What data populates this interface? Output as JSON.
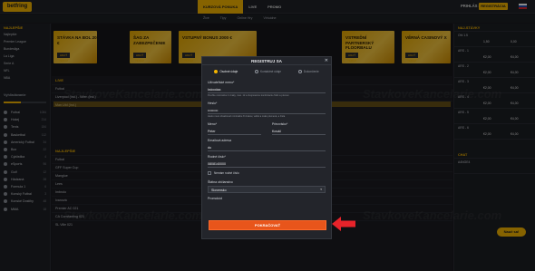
{
  "topbar": {
    "logo": "betfring",
    "nav": [
      "KURZOVÁ PONUKA",
      "LIVE",
      "PROMO"
    ],
    "login": "PRIHLÁS SA",
    "register": "REGISTRÁCIA"
  },
  "subtabs": [
    "Živé",
    "Tipy",
    "Online Hry",
    "Virtuálne"
  ],
  "sidebar": {
    "heading": "NAJLEPŠIE",
    "links": [
      "Najlepšie",
      "Premier League",
      "Bundesliga",
      "La Liga",
      "Serie A",
      "NFL",
      "NBA"
    ],
    "section": "Vyhľadávanie",
    "sports": [
      {
        "name": "Futbal",
        "count": "1084"
      },
      {
        "name": "Hokej",
        "count": "214"
      },
      {
        "name": "Tenis",
        "count": "184"
      },
      {
        "name": "Basketbal",
        "count": "112"
      },
      {
        "name": "Americký Futbal",
        "count": "34"
      },
      {
        "name": "Box",
        "count": "22"
      },
      {
        "name": "Cyklistika",
        "count": "4"
      },
      {
        "name": "eSports",
        "count": "96"
      },
      {
        "name": "Golf",
        "count": "12"
      },
      {
        "name": "Hádzaná",
        "count": "28"
      },
      {
        "name": "Formula 1",
        "count": "6"
      },
      {
        "name": "Konský Futbal",
        "count": "3"
      },
      {
        "name": "Konské Dostihy",
        "count": "48"
      },
      {
        "name": "MMA",
        "count": "18"
      }
    ]
  },
  "banners": [
    {
      "text": "STÁVKA NA BOL 20 €"
    },
    {
      "text": "ŠAG ZA ZABEZPEČENIE"
    },
    {
      "text": "VSTUPNÝ BONUS 2000 €"
    },
    {
      "text": "VSTREĎNÍ PARTNERSKÝ FLOORBALU"
    },
    {
      "text": "VĚRNÁ CASINOVÝ X"
    }
  ],
  "banner_button": "HRAŤ TERAZ",
  "sections": {
    "live": "LIVE",
    "prematch": "NAJLEPŠIE",
    "rows_live": [
      "Futbal",
      "Liverpool (Ind.) - Wien (Ind.)",
      "Man Utd (Ind.)"
    ],
    "rows_pre": [
      "Futbal",
      "GFF Super Cup",
      "Manglue",
      "Lees",
      "Imbrolo",
      "Ivanovic",
      "Premier AC 021",
      "CA Constanting 021",
      "SL Ville 021"
    ]
  },
  "right": {
    "heading": "NAJ-STÁVKY",
    "rows": [
      {
        "name": "Ohl 1.5",
        "o1": "1,50",
        "o2": "0,00"
      },
      {
        "name": "ARS - 1",
        "o1": "€2,00",
        "o2": "€4,00"
      },
      {
        "name": "ARS - 2",
        "o1": "€2,00",
        "o2": "€4,00"
      },
      {
        "name": "ARS - 3",
        "o1": "€2,00",
        "o2": "€4,00"
      },
      {
        "name": "ARS - 4",
        "o1": "€2,00",
        "o2": "€4,00"
      },
      {
        "name": "ARS - 5",
        "o1": "€2,00",
        "o2": "€4,00"
      },
      {
        "name": "ARS - 6",
        "o1": "€2,00",
        "o2": "€4,00"
      }
    ],
    "chat": "CHAT",
    "chat_user": "A4NGE4",
    "help": "Nauč sa!"
  },
  "modal": {
    "title": "REGISTRUJ SA",
    "close": "✕",
    "steps": [
      "Osobné údaje",
      "Kontaktné údaje",
      "Dokončenie"
    ],
    "username_label": "Užívateľské meno*",
    "username_value": "ksioodaa",
    "username_hint": "Použite minimálne 4 znaky, max. 12 a dvojmiestnu kombináciu číslic a písmen",
    "password_label": "Heslo*",
    "password_value": "•••••••••",
    "password_hint": "Heslo musí obsahovať minimálne 8 znakov, veľké a malé písmená, a čísla",
    "first_label": "Meno*",
    "first_value": "Peter",
    "last_label": "Priezvisko*",
    "last_value": "Kováč",
    "email_label": "Emailová adresa",
    "email_value": "du",
    "birth_label": "Rodné číslo*",
    "birth_value": "0808140000",
    "nobirth": "Nemám rodné číslo",
    "country_label": "Štátna občianstvo",
    "country_value": "Slovensko",
    "promo_label": "Promokód",
    "submit": "POKRAČOVAŤ"
  },
  "watermark": "StavkoveKancelarie.com",
  "colors": {
    "accent": "#f4b400",
    "submit": "#e8551b",
    "arrow": "#e8232a"
  }
}
